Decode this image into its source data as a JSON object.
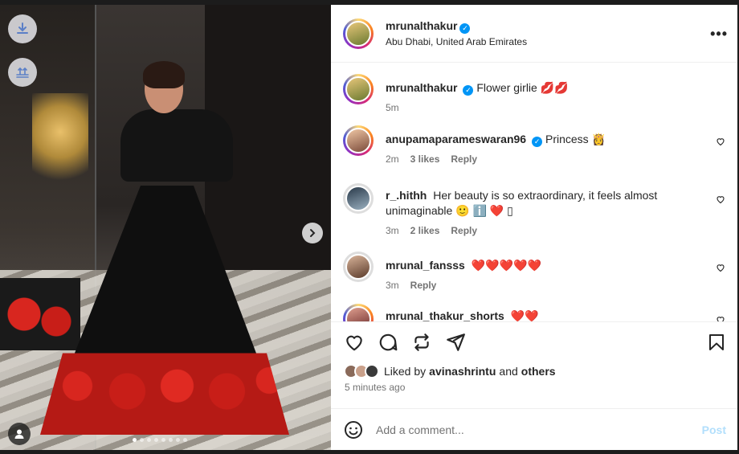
{
  "post": {
    "username": "mrunalthakur",
    "location": "Abu Dhabi, United Arab Emirates",
    "verified_icon": "verified-badge-icon",
    "more_label": "•••"
  },
  "caption": {
    "username": "mrunalthakur",
    "text": "Flower girlie 💋💋",
    "time": "5m"
  },
  "comments": [
    {
      "username": "anupamaparameswaran96",
      "verified": true,
      "text": "Princess 👸",
      "time": "2m",
      "likes": "3 likes",
      "reply": "Reply"
    },
    {
      "username": "r_.hithh",
      "verified": false,
      "text": "Her beauty is so extraordinary, it feels almost unimaginable 🙂 ℹ️ ❤️ ▯",
      "time": "3m",
      "likes": "2 likes",
      "reply": "Reply"
    },
    {
      "username": "mrunal_fansss",
      "verified": false,
      "text": "❤️❤️❤️❤️❤️",
      "time": "3m",
      "likes": "",
      "reply": "Reply"
    },
    {
      "username": "mrunal_thakur_shorts",
      "verified": false,
      "text": "❤️❤️",
      "time": "",
      "likes": "",
      "reply": ""
    }
  ],
  "likes": {
    "prefix": "Liked by",
    "user": "avinashrintu",
    "and": "and",
    "others": "others"
  },
  "post_time": "5 minutes ago",
  "add_comment": {
    "placeholder": "Add a comment...",
    "post_label": "Post"
  },
  "carousel": {
    "count": 8,
    "active_index": 0
  },
  "colors": {
    "accent": "#0095f6",
    "post_disabled": "#b2dffc",
    "text": "#262626",
    "muted": "#737373"
  }
}
